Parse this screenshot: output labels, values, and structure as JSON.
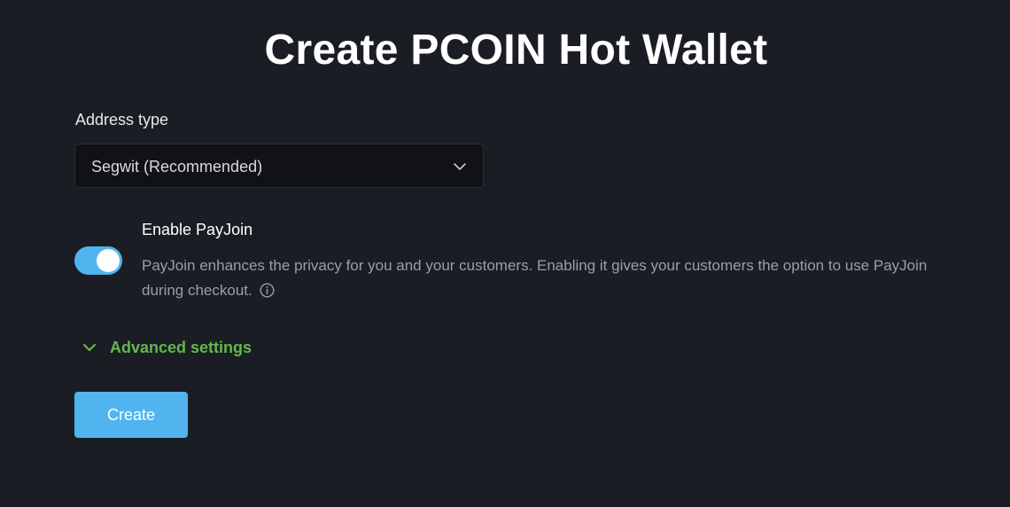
{
  "page": {
    "title": "Create PCOIN Hot Wallet"
  },
  "address_type": {
    "label": "Address type",
    "selected": "Segwit (Recommended)",
    "icon": "chevron-down-icon"
  },
  "payjoin": {
    "label": "Enable PayJoin",
    "enabled": true,
    "description": "PayJoin enhances the privacy for you and your customers. Enabling it gives your customers the option to use PayJoin during checkout.",
    "info_icon": "info-icon"
  },
  "advanced": {
    "label": "Advanced settings",
    "icon": "chevron-down-icon"
  },
  "actions": {
    "create_label": "Create"
  },
  "colors": {
    "background": "#1b1d24",
    "primary": "#51b4ee",
    "link_green": "#62b94b",
    "muted_text": "#9a9ea8"
  }
}
